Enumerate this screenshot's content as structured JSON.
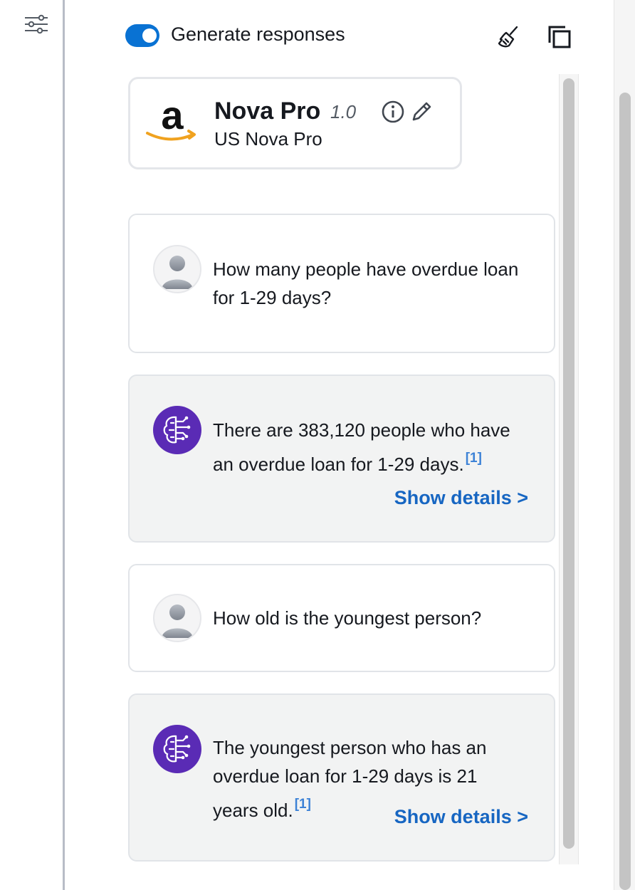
{
  "header": {
    "toggle_label": "Generate responses",
    "toggle_on": true,
    "accent_color": "#0972d3",
    "icons": [
      "settings-sliders-icon",
      "broom-icon",
      "copy-icon"
    ]
  },
  "model": {
    "name": "Nova Pro",
    "version": "1.0",
    "subtitle": "US Nova Pro",
    "logo": "amazon-logo",
    "icons": [
      "info-icon",
      "pencil-icon"
    ]
  },
  "messages": [
    {
      "role": "user",
      "text": "How many people have overdue loan for 1-29 days?"
    },
    {
      "role": "assistant",
      "text": "There are 383,120 people who have an overdue loan for 1-29 days.",
      "citation": "[1]",
      "details_label": "Show details >"
    },
    {
      "role": "user",
      "text": "How old is the youngest person?"
    },
    {
      "role": "assistant",
      "text": "The youngest person who has an overdue loan for 1-29 days is 21 years old.",
      "citation": "[1]",
      "details_label": "Show details >"
    }
  ],
  "colors": {
    "assistant_avatar": "#5a2bb5",
    "link": "#1766c2",
    "citation": "#3d82d6"
  }
}
